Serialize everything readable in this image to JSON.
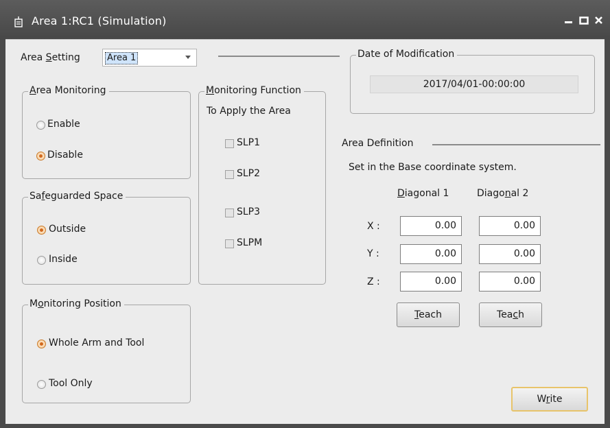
{
  "window": {
    "title": "Area  1:RC1 (Simulation)"
  },
  "area_setting": {
    "label_pre": "Area ",
    "label_key": "S",
    "label_post": "etting",
    "selected": "Area 1"
  },
  "date_modification": {
    "legend": "Date of Modification",
    "value": "2017/04/01-00:00:00"
  },
  "area_monitoring": {
    "legend_key": "A",
    "legend_post": "rea Monitoring",
    "options": [
      {
        "label": "Enable",
        "selected": false
      },
      {
        "label": "Disable",
        "selected": true
      }
    ]
  },
  "safeguarded_space": {
    "legend_pre": "Sa",
    "legend_key": "f",
    "legend_post": "eguarded Space",
    "options": [
      {
        "label": "Outside",
        "selected": true
      },
      {
        "label": "Inside",
        "selected": false
      }
    ]
  },
  "monitoring_position": {
    "legend_pre": "M",
    "legend_key": "o",
    "legend_post": "nitoring Position",
    "options": [
      {
        "label": "Whole Arm and Tool",
        "selected": true
      },
      {
        "label": "Tool Only",
        "selected": false
      }
    ]
  },
  "monitoring_function": {
    "legend_key": "M",
    "legend_post": "onitoring Function",
    "subtitle": "To Apply the Area",
    "items": [
      {
        "label": "SLP1",
        "checked": false
      },
      {
        "label": "SLP2",
        "checked": false
      },
      {
        "label": "SLP3",
        "checked": false
      },
      {
        "label": "SLPM",
        "checked": false
      }
    ]
  },
  "area_definition": {
    "title": "Area Definition",
    "note": "Set in the Base coordinate system.",
    "col1": {
      "key": "D",
      "post": "iagonal 1"
    },
    "col2": {
      "pre": "Diago",
      "key": "n",
      "post": "al 2"
    },
    "rows": [
      {
        "label": "X :",
        "d1": "0.00",
        "d2": "0.00"
      },
      {
        "label": "Y :",
        "d1": "0.00",
        "d2": "0.00"
      },
      {
        "label": "Z :",
        "d1": "0.00",
        "d2": "0.00"
      }
    ],
    "teach1": {
      "key": "T",
      "post": "each"
    },
    "teach2": {
      "pre": "Tea",
      "key": "c",
      "post": "h"
    }
  },
  "write_button": {
    "pre": "W",
    "key": "r",
    "post": "ite"
  },
  "colors": {
    "titlebar": "#4a4a4a",
    "client": "#ececec",
    "radio_accent": "#d2691e",
    "default_button_border": "#e8c46a"
  },
  "icons": [
    "window-icon",
    "minimize-icon",
    "maximize-icon",
    "close-icon",
    "dropdown-arrow-icon"
  ]
}
